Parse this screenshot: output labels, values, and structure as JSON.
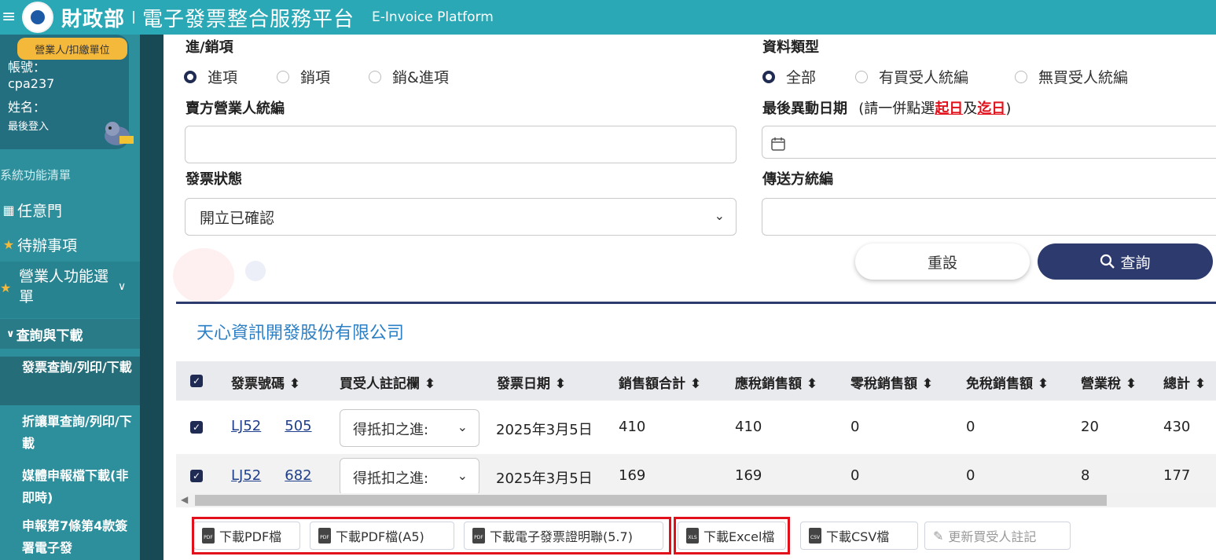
{
  "header": {
    "ministry": "財政部",
    "platform": "電子發票整合服務平台",
    "platform_en": "E-Invoice Platform"
  },
  "sidebar": {
    "role_badge": "營業人/扣繳單位",
    "account_label": "帳號：",
    "account_value": "cpa237",
    "name_label": "姓名：",
    "last_login_label": "最後登入",
    "menu_caption": "系統功能清單",
    "items": [
      {
        "label": "任意門",
        "icon": "map-icon"
      },
      {
        "label": "待辦事項",
        "icon": "star-icon"
      },
      {
        "label": "營業人功能選單",
        "icon": "star-icon"
      }
    ],
    "sub_header": "查詢與下載",
    "sub_items": [
      "發票查詢/列印/下載",
      "折讓單查詢/列印/下載",
      "媒體申報檔下載(非即時)",
      "申報第7條第4款簽署電子發"
    ]
  },
  "form": {
    "in_out_label": "進/銷項",
    "in_out_options": [
      "進項",
      "銷項",
      "銷&進項"
    ],
    "in_out_selected": 0,
    "data_type_label": "資料類型",
    "data_type_options": [
      "全部",
      "有買受人統編",
      "無買受人統編"
    ],
    "data_type_selected": 0,
    "seller_id_label": "賣方營業人統編",
    "last_change_label": "最後異動日期",
    "last_change_hint_pre": "(請一併點選",
    "last_change_hint_start": "起日",
    "last_change_hint_and": "及",
    "last_change_hint_end": "迄日",
    "last_change_hint_post": ")",
    "status_label": "發票狀態",
    "status_value": "開立已確認",
    "sender_id_label": "傳送方統編",
    "reset_label": "重設",
    "query_label": "查詢"
  },
  "results": {
    "company_name": "天心資訊開發股份有限公司",
    "columns": [
      "發票號碼",
      "買受人註記欄",
      "發票日期",
      "銷售額合計",
      "應稅銷售額",
      "零稅銷售額",
      "免稅銷售額",
      "營業稅",
      "總計"
    ],
    "sort_glyph": "⬍",
    "rows": [
      {
        "inv_a": "LJ52",
        "inv_b": "505",
        "note": "得抵扣之進:",
        "date": "2025年3月5日",
        "sales_total": "410",
        "taxable": "410",
        "zero_tax": "0",
        "tax_free": "0",
        "tax": "20",
        "total": "430"
      },
      {
        "inv_a": "LJ52",
        "inv_b": "682",
        "note": "得抵扣之進:",
        "date": "2025年3月5日",
        "sales_total": "169",
        "taxable": "169",
        "zero_tax": "0",
        "tax_free": "0",
        "tax": "8",
        "total": "177"
      }
    ]
  },
  "actions": {
    "pdf": "下載PDF檔",
    "pdf_a5": "下載PDF檔(A5)",
    "proof": "下載電子發票證明聯(5.7)",
    "excel": "下載Excel檔",
    "csv": "下載CSV檔",
    "update_note": "更新買受人註記"
  },
  "colors": {
    "header": "#2aa8b5",
    "sidebar": "#2d8f9c",
    "primary": "#2d3a6e",
    "highlight": "#e1101a",
    "company": "#2b7fc4"
  }
}
